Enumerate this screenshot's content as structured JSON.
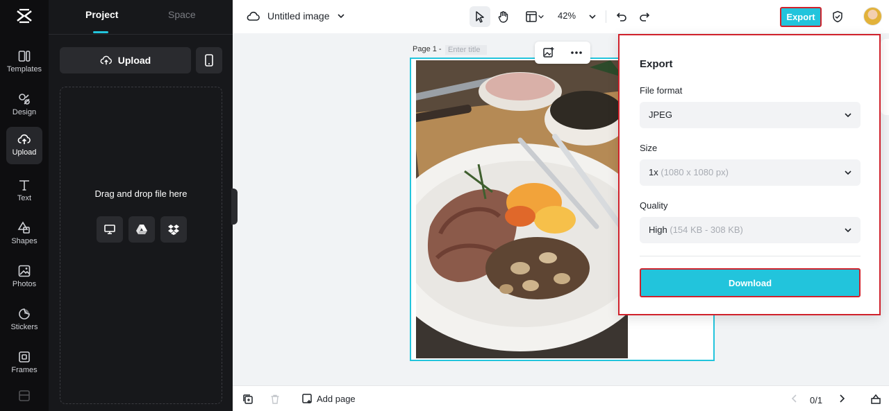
{
  "rail": {
    "items": [
      {
        "label": "Templates",
        "icon": "templates-icon"
      },
      {
        "label": "Design",
        "icon": "design-icon"
      },
      {
        "label": "Upload",
        "icon": "upload-cloud-icon",
        "active": true
      },
      {
        "label": "Text",
        "icon": "text-icon"
      },
      {
        "label": "Shapes",
        "icon": "shapes-icon"
      },
      {
        "label": "Photos",
        "icon": "photos-icon"
      },
      {
        "label": "Stickers",
        "icon": "stickers-icon"
      },
      {
        "label": "Frames",
        "icon": "frames-icon"
      }
    ]
  },
  "panel": {
    "tabs": [
      "Project",
      "Space"
    ],
    "upload_label": "Upload",
    "drop_text": "Drag and drop file here"
  },
  "topbar": {
    "doc_title": "Untitled image",
    "zoom": "42%",
    "export_label": "Export"
  },
  "canvas": {
    "page_label": "Page 1 -",
    "title_placeholder": "Enter title"
  },
  "export_panel": {
    "title": "Export",
    "file_format_label": "File format",
    "file_format_value": "JPEG",
    "size_label": "Size",
    "size_value": "1x",
    "size_detail": "(1080 x 1080 px)",
    "quality_label": "Quality",
    "quality_value": "High",
    "quality_detail": "(154 KB - 308 KB)",
    "download_label": "Download"
  },
  "bottombar": {
    "add_page_label": "Add page",
    "pager": "0/1"
  },
  "colors": {
    "accent": "#22c4dc",
    "highlight": "#d0212b",
    "rail_bg": "#0e0e10",
    "panel_bg": "#17181b"
  }
}
